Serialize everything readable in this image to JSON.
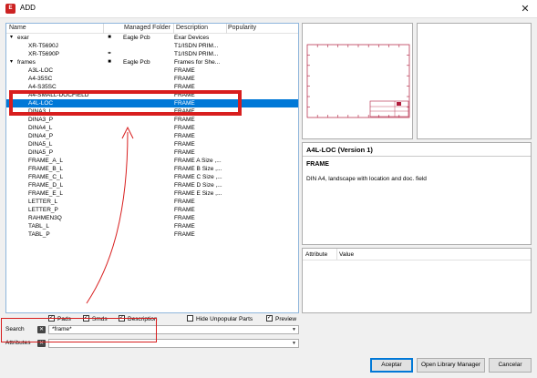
{
  "window": {
    "title": "ADD",
    "icon": "eagle-app-icon",
    "close_glyph": "✕"
  },
  "tree": {
    "columns": [
      "Name",
      "Managed Folder",
      "Description",
      "Popularity"
    ],
    "rows": [
      {
        "expander": "▾",
        "name": "exar",
        "flag": "■",
        "folder": "Eagle Pcb",
        "desc": "Exar Devices",
        "indent": 0,
        "selected": false
      },
      {
        "expander": "",
        "name": "XR-T5690J",
        "flag": "",
        "folder": "",
        "desc": "T1/ISDN PRIM...",
        "indent": 2,
        "selected": false
      },
      {
        "expander": "",
        "name": "XR-T5690P",
        "flag": "⚭",
        "folder": "",
        "desc": "T1/ISDN PRIM...",
        "indent": 2,
        "selected": false
      },
      {
        "expander": "▾",
        "name": "frames",
        "flag": "■",
        "folder": "Eagle Pcb",
        "desc": "Frames for She...",
        "indent": 0,
        "selected": false
      },
      {
        "expander": "",
        "name": "A3L-LOC",
        "flag": "",
        "folder": "",
        "desc": "FRAME",
        "indent": 2,
        "selected": false
      },
      {
        "expander": "",
        "name": "A4-35SC",
        "flag": "",
        "folder": "",
        "desc": "FRAME",
        "indent": 2,
        "selected": false
      },
      {
        "expander": "",
        "name": "A4-S35SC",
        "flag": "",
        "folder": "",
        "desc": "FRAME",
        "indent": 2,
        "selected": false
      },
      {
        "expander": "",
        "name": "A4-SMALL-DOCFIELD",
        "flag": "",
        "folder": "",
        "desc": "FRAME",
        "indent": 2,
        "selected": false
      },
      {
        "expander": "",
        "name": "A4L-LOC",
        "flag": "",
        "folder": "",
        "desc": "FRAME",
        "indent": 2,
        "selected": true
      },
      {
        "expander": "",
        "name": "DINA3_L",
        "flag": "",
        "folder": "",
        "desc": "FRAME",
        "indent": 2,
        "selected": false
      },
      {
        "expander": "",
        "name": "DINA3_P",
        "flag": "",
        "folder": "",
        "desc": "FRAME",
        "indent": 2,
        "selected": false
      },
      {
        "expander": "",
        "name": "DINA4_L",
        "flag": "",
        "folder": "",
        "desc": "FRAME",
        "indent": 2,
        "selected": false
      },
      {
        "expander": "",
        "name": "DINA4_P",
        "flag": "",
        "folder": "",
        "desc": "FRAME",
        "indent": 2,
        "selected": false
      },
      {
        "expander": "",
        "name": "DINA5_L",
        "flag": "",
        "folder": "",
        "desc": "FRAME",
        "indent": 2,
        "selected": false
      },
      {
        "expander": "",
        "name": "DINA5_P",
        "flag": "",
        "folder": "",
        "desc": "FRAME",
        "indent": 2,
        "selected": false
      },
      {
        "expander": "",
        "name": "FRAME_A_L",
        "flag": "",
        "folder": "",
        "desc": "FRAME A Size ,...",
        "indent": 2,
        "selected": false
      },
      {
        "expander": "",
        "name": "FRAME_B_L",
        "flag": "",
        "folder": "",
        "desc": "FRAME B Size ,...",
        "indent": 2,
        "selected": false
      },
      {
        "expander": "",
        "name": "FRAME_C_L",
        "flag": "",
        "folder": "",
        "desc": "FRAME C Size ,...",
        "indent": 2,
        "selected": false
      },
      {
        "expander": "",
        "name": "FRAME_D_L",
        "flag": "",
        "folder": "",
        "desc": "FRAME D Size ,...",
        "indent": 2,
        "selected": false
      },
      {
        "expander": "",
        "name": "FRAME_E_L",
        "flag": "",
        "folder": "",
        "desc": "FRAME E Size ,...",
        "indent": 2,
        "selected": false
      },
      {
        "expander": "",
        "name": "LETTER_L",
        "flag": "",
        "folder": "",
        "desc": "FRAME",
        "indent": 2,
        "selected": false
      },
      {
        "expander": "",
        "name": "LETTER_P",
        "flag": "",
        "folder": "",
        "desc": "FRAME",
        "indent": 2,
        "selected": false
      },
      {
        "expander": "",
        "name": "RAHMEN3Q",
        "flag": "",
        "folder": "",
        "desc": "FRAME",
        "indent": 2,
        "selected": false
      },
      {
        "expander": "",
        "name": "TABL_L",
        "flag": "",
        "folder": "",
        "desc": "FRAME",
        "indent": 2,
        "selected": false
      },
      {
        "expander": "",
        "name": "TABL_P",
        "flag": "",
        "folder": "",
        "desc": "FRAME",
        "indent": 2,
        "selected": false
      }
    ]
  },
  "details": {
    "title": "A4L-LOC (Version 1)",
    "subtitle": "FRAME",
    "text": "DIN A4, landscape with location and doc. field"
  },
  "attributes": {
    "columns": [
      "Attribute",
      "Value"
    ]
  },
  "filters": [
    {
      "label": "Pads",
      "checked": true
    },
    {
      "label": "Smds",
      "checked": true
    },
    {
      "label": "Description",
      "checked": true
    },
    {
      "label": "Hide Unpopular Parts",
      "checked": false
    },
    {
      "label": "Preview",
      "checked": true
    }
  ],
  "search": {
    "label": "Search",
    "value": "*frame*"
  },
  "attributes_filter": {
    "label": "Attributes",
    "value": ""
  },
  "buttons": {
    "accept": "Aceptar",
    "open_manager": "Open Library Manager",
    "cancel": "Cancelar"
  },
  "colors": {
    "selection": "#0078d7",
    "annotation": "#d81e1e",
    "frame_drawing": "#b01c3c"
  },
  "icons": {
    "clear": "clear-icon",
    "dropdown": "chevron-down-icon",
    "expand": "expander-icon"
  }
}
